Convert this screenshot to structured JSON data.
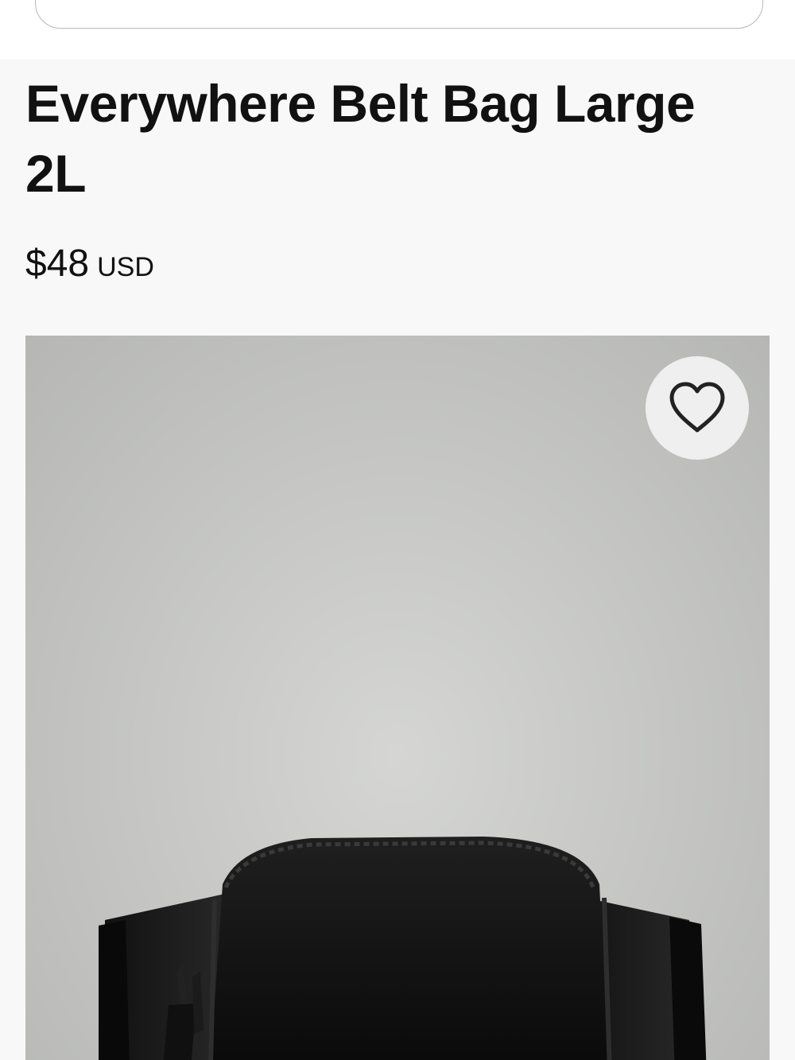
{
  "product": {
    "title": "Everywhere Belt Bag Large 2L",
    "price": "$48",
    "currency": "USD"
  },
  "icons": {
    "favorite": "heart-outline-icon"
  },
  "colors": {
    "text": "#111111",
    "panel_background": "#f8f8f8",
    "image_background": "#c9cac8",
    "bag": "#111111"
  }
}
